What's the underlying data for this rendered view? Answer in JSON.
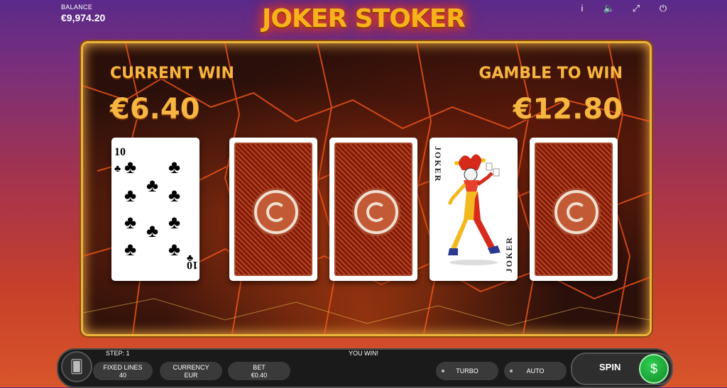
{
  "header": {
    "balance_label": "BALANCE",
    "balance_value": "€9,974.20",
    "logo_text": "JOKER STOKER",
    "icons": [
      "info-icon",
      "sound-icon",
      "fullscreen-icon",
      "power-icon"
    ],
    "icon_glyphs": [
      "i",
      "🔈",
      "⤢",
      "⏻"
    ]
  },
  "board": {
    "current_win_label": "CURRENT WIN",
    "current_win_value": "€6.40",
    "gamble_label": "GAMBLE TO WIN",
    "gamble_value": "€12.80",
    "cards": [
      {
        "state": "face-up",
        "rank": "10",
        "suit": "♣"
      },
      {
        "state": "face-down"
      },
      {
        "state": "face-down"
      },
      {
        "state": "face-up",
        "rank": "JOKER"
      },
      {
        "state": "face-down"
      }
    ]
  },
  "bottom": {
    "step": "STEP: 1",
    "status": "YOU WIN!",
    "fixed_lines_label": "FIXED LINES",
    "fixed_lines_value": "40",
    "currency_label": "CURRENCY",
    "currency_value": "EUR",
    "bet_label": "BET",
    "bet_value": "€0.40",
    "turbo_label": "TURBO",
    "auto_label": "AUTO",
    "spin_label": "SPIN"
  },
  "colors": {
    "gold": "#f7b541",
    "board_border": "#e9b53b",
    "spin_green": "#2fcf4f",
    "card_back": "#b8502c"
  }
}
